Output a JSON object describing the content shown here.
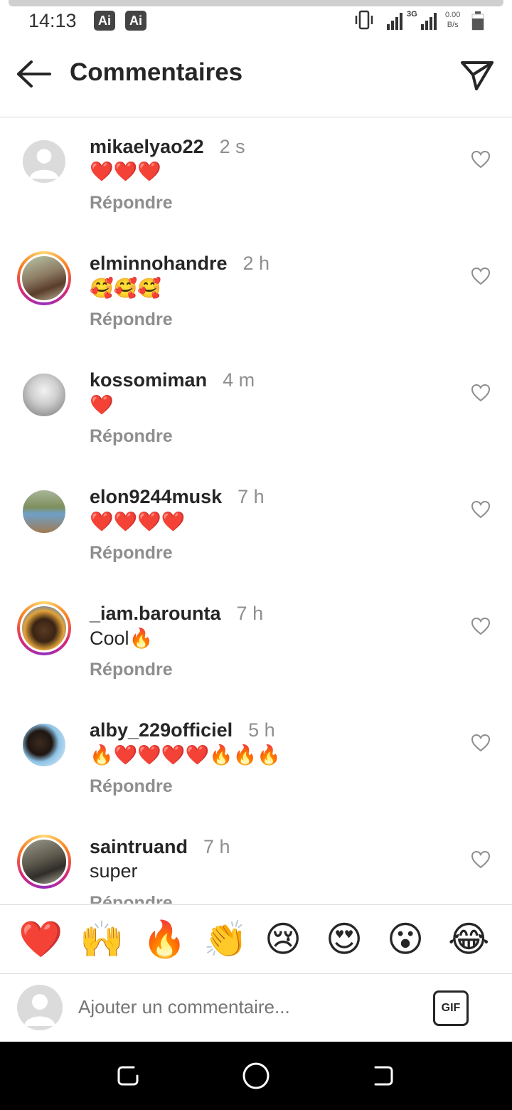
{
  "status_bar": {
    "time": "14:13",
    "badges": [
      "Ai",
      "Ai"
    ],
    "network": "3G",
    "speed_value": "0.00",
    "speed_unit": "B/s"
  },
  "header": {
    "title": "Commentaires",
    "back_icon": "arrow-left-icon",
    "share_icon": "paper-plane-icon"
  },
  "comments": [
    {
      "username": "mikaelyao22",
      "ago": "2 s",
      "text": "❤️❤️❤️",
      "reply": "Répondre",
      "avatar": "default",
      "story_ring": false
    },
    {
      "username": "elminnohandre",
      "ago": "2 h",
      "text": "🥰🥰🥰",
      "reply": "Répondre",
      "avatar": "photo",
      "story_ring": true
    },
    {
      "username": "kossomiman",
      "ago": "4 m",
      "text": "❤️",
      "reply": "Répondre",
      "avatar": "photo",
      "story_ring": false
    },
    {
      "username": "elon9244musk",
      "ago": "7 h",
      "text": "❤️❤️❤️❤️",
      "reply": "Répondre",
      "avatar": "photo",
      "story_ring": false
    },
    {
      "username": "_iam.barounta",
      "ago": "7 h",
      "text": "Cool🔥",
      "reply": "Répondre",
      "avatar": "photo",
      "story_ring": true
    },
    {
      "username": "alby_229officiel",
      "ago": "5 h",
      "text": "🔥❤️❤️❤️❤️🔥🔥🔥",
      "reply": "Répondre",
      "avatar": "photo",
      "story_ring": false
    },
    {
      "username": "saintruand",
      "ago": "7 h",
      "text": "super",
      "reply": "Répondre",
      "avatar": "photo",
      "story_ring": true
    }
  ],
  "quick_reactions": [
    "❤️",
    "🙌",
    "🔥",
    "👏",
    "😢",
    "😍",
    "😮",
    "😂"
  ],
  "composer": {
    "placeholder": "Ajouter un commentaire...",
    "gif_label": "GIF"
  },
  "nav_bar": {
    "icons": [
      "recents-icon",
      "home-icon",
      "back-icon"
    ]
  },
  "colors": {
    "text": "#262626",
    "secondary": "#8e8e8e",
    "divider": "#dbdbdb",
    "nav_bar": "#000000"
  }
}
